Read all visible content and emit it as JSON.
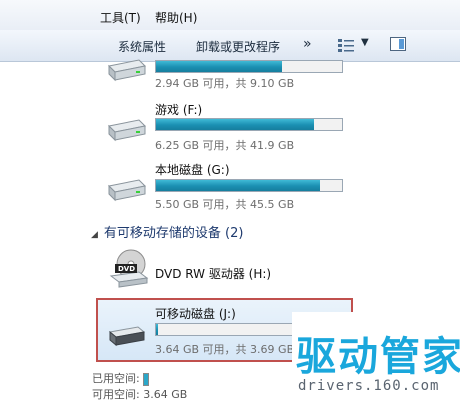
{
  "menubar": {
    "items": [
      {
        "label": "工具(T)"
      },
      {
        "label": "帮助(H)"
      }
    ]
  },
  "toolbar": {
    "system_properties": "系统属性",
    "uninstall": "卸载或更改程序",
    "more": "»"
  },
  "drives": [
    {
      "name": "",
      "info": "2.94 GB 可用，共 9.10 GB",
      "used_fraction": 0.68
    },
    {
      "name": "游戏 (F:)",
      "info": "6.25 GB 可用，共 41.9 GB",
      "used_fraction": 0.85
    },
    {
      "name": "本地磁盘 (G:)",
      "info": "5.50 GB 可用，共 45.5 GB",
      "used_fraction": 0.88
    }
  ],
  "removable_section": {
    "header": "有可移动存储的设备 (2)"
  },
  "dvd": {
    "name": "DVD RW 驱动器 (H:)",
    "badge": "DVD"
  },
  "removable_disk": {
    "name": "可移动磁盘 (J:)",
    "info": "3.64 GB 可用，共 3.69 GB",
    "used_fraction": 0.014
  },
  "status": {
    "used_label": "已用空间:",
    "free_label": "可用空间:",
    "free_value": "3.64 GB"
  },
  "watermark": {
    "title": "驱动管家",
    "url": "drivers.160.com"
  },
  "colors": {
    "bar_fill": "#1a8fb2",
    "selection_border": "#c0504d",
    "logo": "#1aa7dc"
  }
}
